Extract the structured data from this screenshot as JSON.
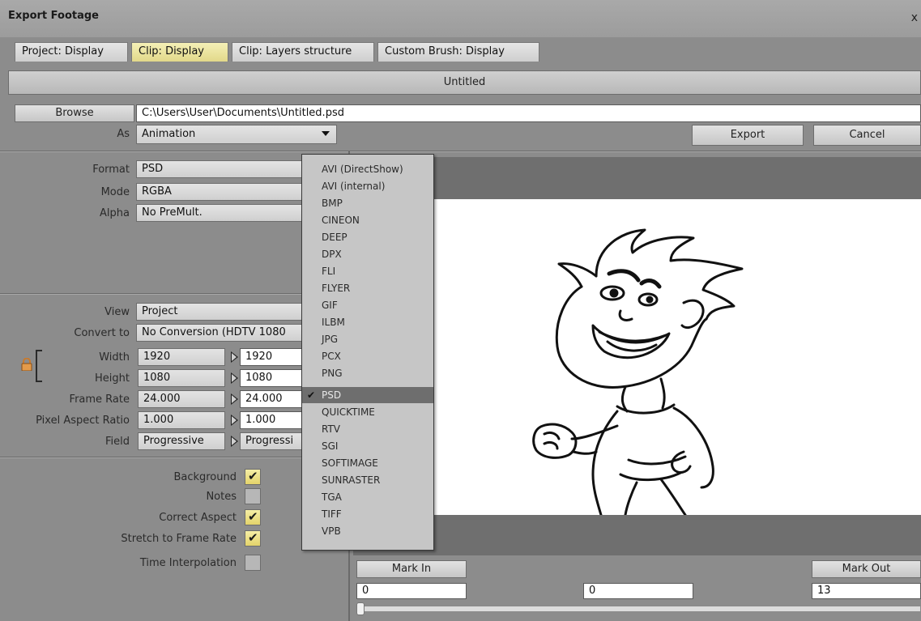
{
  "window": {
    "title": "Export Footage",
    "close_glyph": "x"
  },
  "tabs": [
    {
      "label": "Project: Display",
      "active": false
    },
    {
      "label": "Clip: Display",
      "active": true
    },
    {
      "label": "Clip: Layers structure",
      "active": false
    },
    {
      "label": "Custom Brush: Display",
      "active": false
    }
  ],
  "file": {
    "name": "Untitled",
    "browse_label": "Browse",
    "path": "C:\\Users\\User\\Documents\\Untitled.psd",
    "as_label": "As",
    "as_value": "Animation",
    "export_label": "Export",
    "cancel_label": "Cancel"
  },
  "format_settings": {
    "format_label": "Format",
    "format_value": "PSD",
    "mode_label": "Mode",
    "mode_value": "RGBA",
    "alpha_label": "Alpha",
    "alpha_value": "No PreMult."
  },
  "view_settings": {
    "view_label": "View",
    "view_value": "Project",
    "convert_label": "Convert to",
    "convert_value": "No Conversion (HDTV 1080",
    "width_label": "Width",
    "width_source": "1920",
    "width_target": "1920",
    "height_label": "Height",
    "height_source": "1080",
    "height_target": "1080",
    "framerate_label": "Frame Rate",
    "framerate_source": "24.000",
    "framerate_target": "24.000",
    "par_label": "Pixel Aspect Ratio",
    "par_source": "1.000",
    "par_target": "1.000",
    "field_label": "Field",
    "field_source": "Progressive",
    "field_target": "Progressi"
  },
  "options": [
    {
      "label": "Background",
      "checked": true
    },
    {
      "label": "Notes",
      "checked": false
    },
    {
      "label": "Correct Aspect",
      "checked": true
    },
    {
      "label": "Stretch to Frame Rate",
      "checked": true
    },
    {
      "label": "Time Interpolation",
      "checked": false
    }
  ],
  "format_list": [
    "AVI (DirectShow)",
    "AVI (internal)",
    "BMP",
    "CINEON",
    "DEEP",
    "DPX",
    "FLI",
    "FLYER",
    "GIF",
    "ILBM",
    "JPG",
    "PCX",
    "PNG",
    "PSD",
    "QUICKTIME",
    "RTV",
    "SGI",
    "SOFTIMAGE",
    "SUNRASTER",
    "TGA",
    "TIFF",
    "VPB"
  ],
  "format_list_selected": "PSD",
  "timeline": {
    "mark_in_label": "Mark In",
    "mark_out_label": "Mark Out",
    "in_value": "0",
    "current_value": "0",
    "out_value": "13"
  },
  "icons": {
    "lock": "lock-icon",
    "check": "check-icon",
    "dropdown": "chevron-down-icon",
    "arrow": "triangle-right-icon"
  }
}
